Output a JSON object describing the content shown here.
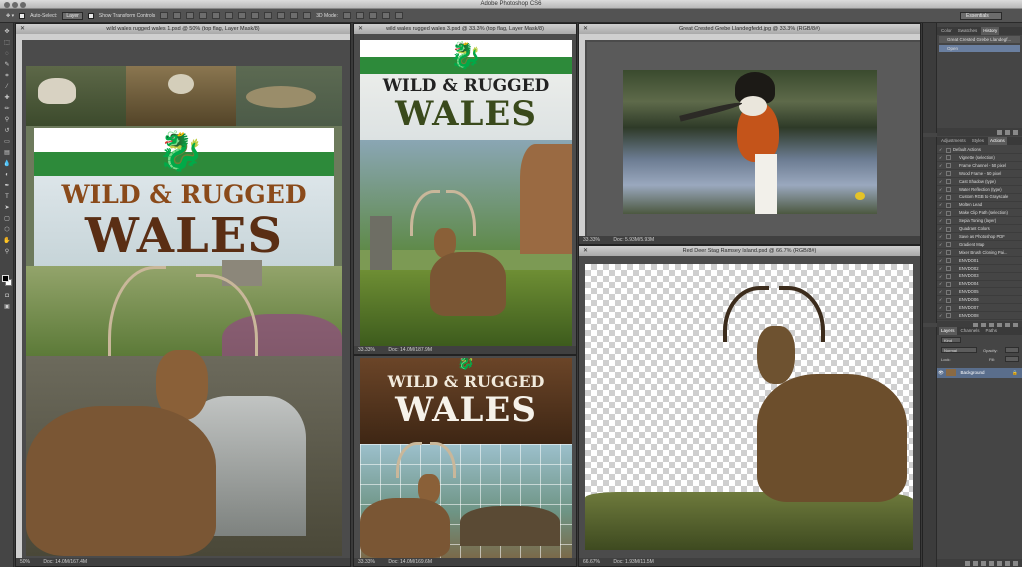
{
  "app": {
    "title": "Adobe Photoshop CS6"
  },
  "options_bar": {
    "auto_select_label": "Auto-Select:",
    "auto_select_value": "Layer",
    "transform_label": "Show Transform Controls",
    "mode_label": "3D Mode:",
    "workspace": "Essentials"
  },
  "documents": [
    {
      "title": "wild wales rugged wales 1.psd @ 50% (top flag, Layer Mask/8)",
      "zoom": "50%",
      "doc_size": "Doc: 14.0M/167.4M"
    },
    {
      "title": "wild wales rugged wales 3.psd @ 33.3% (top flag, Layer Mask/8)",
      "zoom": "33.33%",
      "doc_size": "Doc: 14.0M/187.9M"
    },
    {
      "title": "wild wales rugged wales 2.psd",
      "zoom": "33.33%",
      "doc_size": "Doc: 14.0M/169.6M"
    },
    {
      "title": "Great Crested Grebe Llandegfedd.jpg @ 33.3% (RGB/8#)",
      "zoom": "33.33%",
      "doc_size": "Doc: 5.93M/5.93M"
    },
    {
      "title": "Red Deer Stag Ramsey Island.psd @ 66.7% (RGB/8#)",
      "zoom": "66.67%",
      "doc_size": "Doc: 1.93M/11.5M"
    }
  ],
  "poster": {
    "sub_title": "WILD & RUGGED",
    "main_title": "WALES",
    "dragon_glyph": "🐉"
  },
  "panels": {
    "history_tabs": [
      "Color",
      "Swatches",
      "History"
    ],
    "history_active": "History",
    "history_items": [
      "Great Crested Grebe Llandegf...",
      "Open"
    ],
    "actions_tabs": [
      "Adjustments",
      "Styles",
      "Actions"
    ],
    "actions_active": "Actions",
    "actions": [
      "Default Actions",
      "Vignette (selection)",
      "Frame Channel - 50 pixel",
      "Wood Frame - 50 pixel",
      "Cast Shadow (type)",
      "Water Reflection (type)",
      "Custom RGB to Grayscale",
      "Molten Lead",
      "Make Clip Path (selection)",
      "Sepia Toning (layer)",
      "Quadrant Colors",
      "Save as Photoshop PDF",
      "Gradient Map",
      "Mixer Brush Cloning Pai...",
      "ENVDO01",
      "ENVDO02",
      "ENVDO03",
      "ENVDO04",
      "ENVDO05",
      "ENVDO06",
      "ENVDO07",
      "ENVDO08"
    ],
    "layers_tabs": [
      "Layers",
      "Channels",
      "Paths"
    ],
    "layers_active": "Layers",
    "kind_label": "Kind",
    "blend_mode": "Normal",
    "opacity_label": "Opacity:",
    "lock_label": "Lock:",
    "fill_label": "Fill:",
    "layer_name": "Background"
  }
}
